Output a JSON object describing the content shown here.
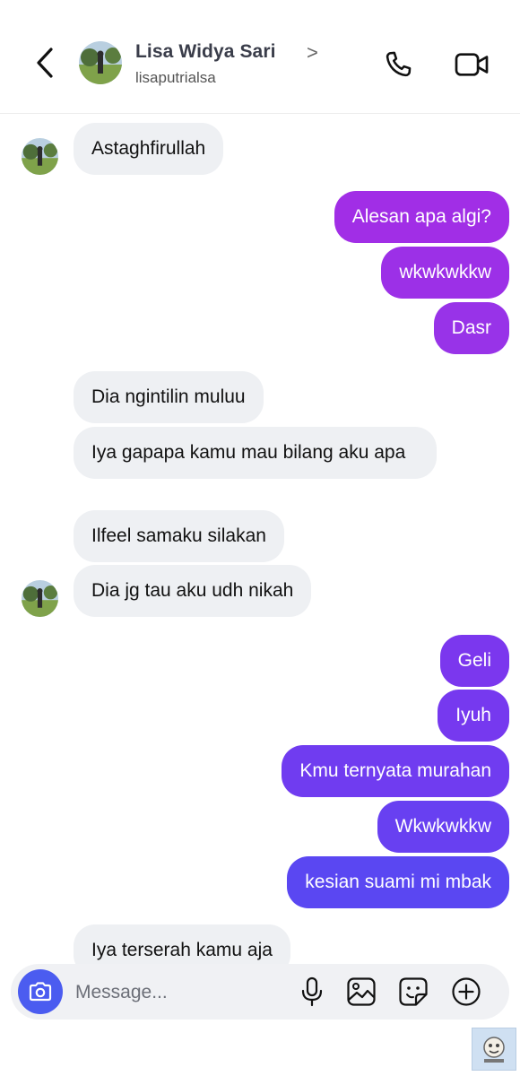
{
  "header": {
    "name": "Lisa Widya Sari",
    "chevron": ">",
    "username": "lisaputrialsa"
  },
  "messages": [
    {
      "side": "in",
      "text": "Astaghfirullah"
    },
    {
      "side": "out",
      "text": "Alesan apa algi?"
    },
    {
      "side": "out",
      "text": "wkwkwkkw"
    },
    {
      "side": "out",
      "text": "Dasr"
    },
    {
      "side": "in",
      "text": "Dia ngintilin muluu"
    },
    {
      "side": "in",
      "text": "Iya gapapa kamu mau bilang aku apa"
    },
    {
      "side": "in",
      "text": "Ilfeel samaku silakan"
    },
    {
      "side": "in",
      "text": "Dia jg tau aku udh nikah"
    },
    {
      "side": "out",
      "text": "Geli"
    },
    {
      "side": "out",
      "text": "Iyuh"
    },
    {
      "side": "out",
      "text": "Kmu ternyata murahan"
    },
    {
      "side": "out",
      "text": "Wkwkwkkw"
    },
    {
      "side": "out",
      "text": "kesian suami mi mbak"
    },
    {
      "side": "in",
      "text": "Iya terserah kamu aja"
    }
  ],
  "composer": {
    "placeholder": "Message..."
  },
  "colors": {
    "outgoing_top": "#a12ee6",
    "outgoing_mid": "#7b37ee",
    "outgoing_bottom": "#5a47f2",
    "incoming": "#eef0f3",
    "camera_button": "#4b5cf0"
  },
  "icons": [
    "back-icon",
    "phone-icon",
    "video-camera-icon",
    "camera-icon",
    "microphone-icon",
    "image-icon",
    "sticker-icon",
    "plus-icon"
  ]
}
